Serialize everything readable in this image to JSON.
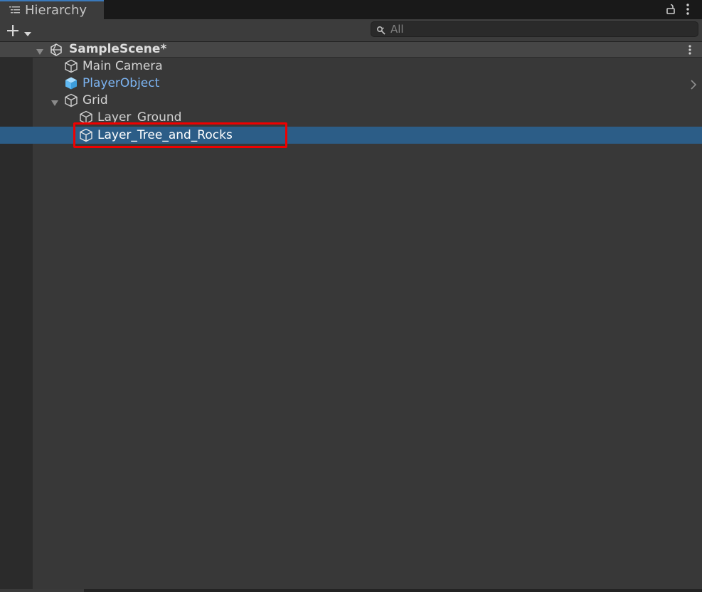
{
  "window": {
    "tab_label": "Hierarchy",
    "tab_icon": "hierarchy-list-icon",
    "lock_icon": "lock-icon",
    "menu_icon": "kebab-menu-icon"
  },
  "toolbar": {
    "add_icon": "plus-icon",
    "add_dropdown_icon": "caret-down-icon",
    "search": {
      "icon": "search-icon",
      "placeholder": "All",
      "value": ""
    }
  },
  "scene": {
    "name": "SampleScene*",
    "icon": "unity-scene-icon",
    "expanded": true,
    "menu_icon": "kebab-menu-icon"
  },
  "items": [
    {
      "label": "Main Camera",
      "icon": "gameobject-cube-icon",
      "depth": 1,
      "color": "#d2d2d2",
      "expanded": null,
      "selected": false
    },
    {
      "label": "PlayerObject",
      "icon": "prefab-cube-icon",
      "depth": 1,
      "color": "#7cb4f2",
      "expanded": null,
      "selected": false
    },
    {
      "label": "Grid",
      "icon": "gameobject-cube-icon",
      "depth": 1,
      "color": "#d2d2d2",
      "expanded": true,
      "selected": false
    },
    {
      "label": "Layer_Ground",
      "icon": "gameobject-cube-icon",
      "depth": 2,
      "color": "#d2d2d2",
      "expanded": null,
      "selected": false
    },
    {
      "label": "Layer_Tree_and_Rocks",
      "icon": "gameobject-cube-icon",
      "depth": 2,
      "color": "#ffffff",
      "expanded": null,
      "selected": true
    }
  ],
  "colors": {
    "selection": "#2c5d87",
    "highlight_box": "#ef0000",
    "prefab_text": "#7cb4f2",
    "prefab_icon": "#6ec1f5"
  }
}
